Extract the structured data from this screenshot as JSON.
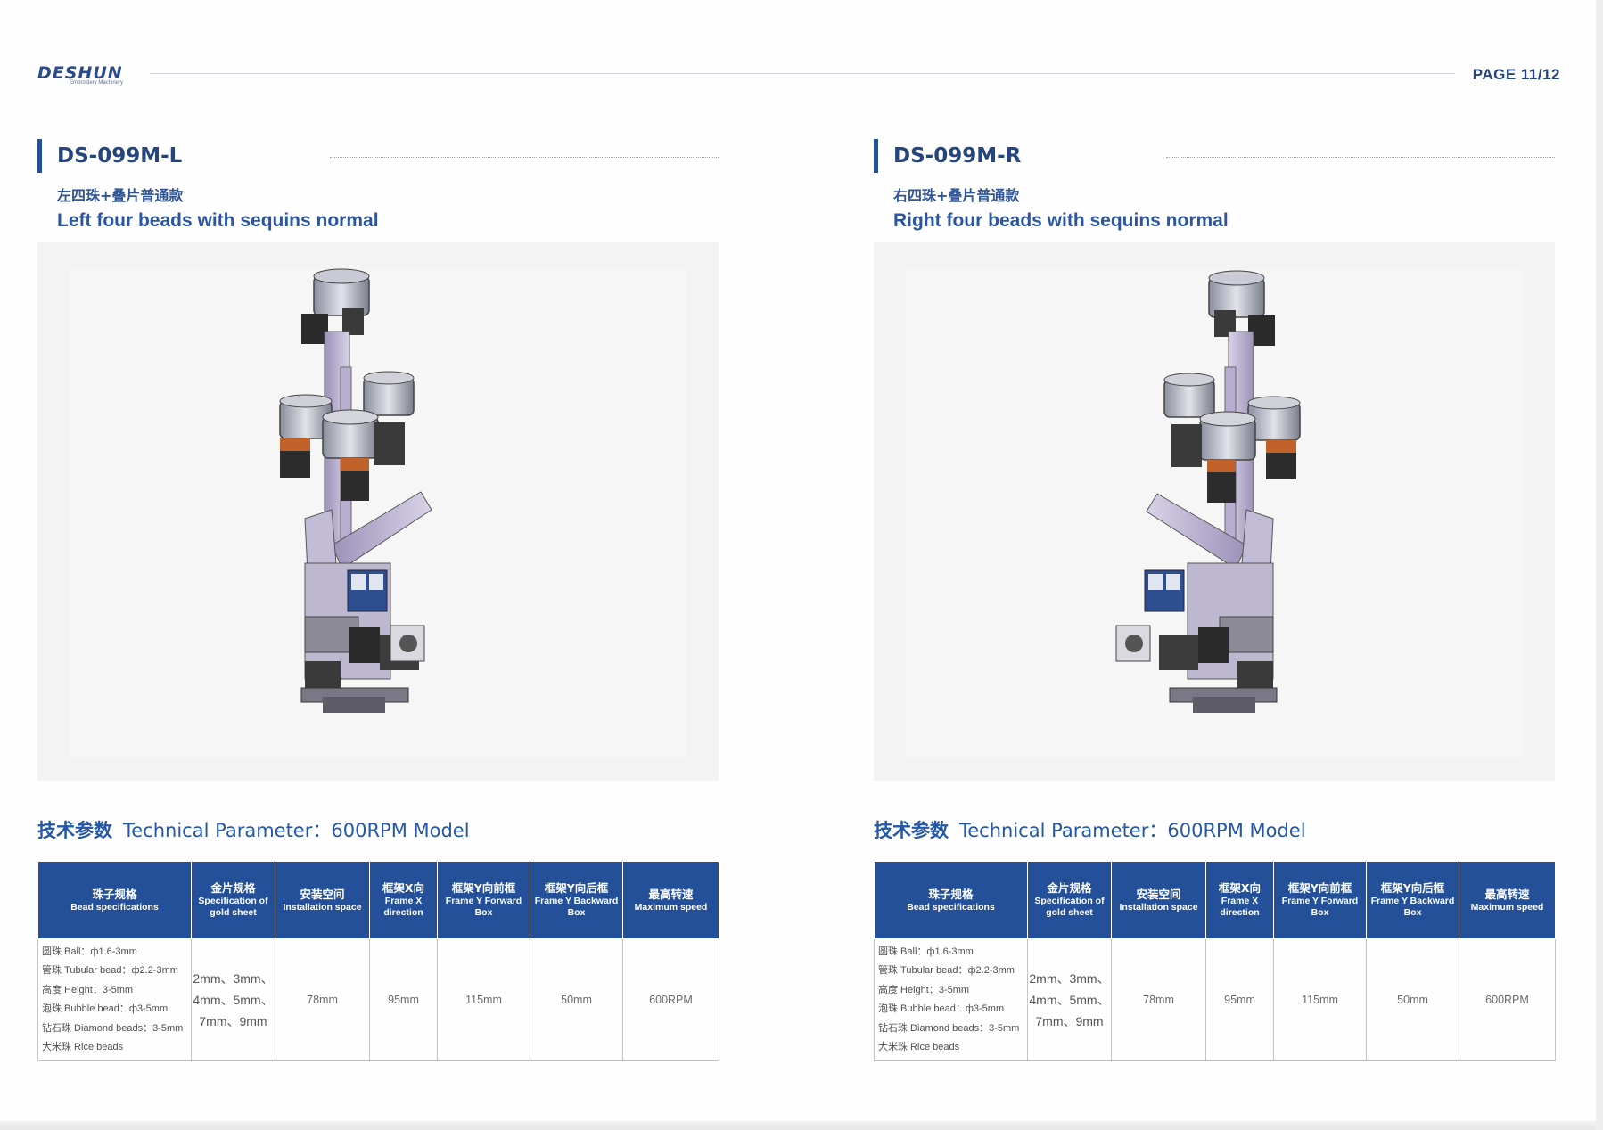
{
  "header": {
    "logo_text": "DESHUN",
    "logo_subtext": "Embroidery Machinery",
    "page_number": "PAGE 11/12"
  },
  "colors": {
    "brand_blue": "#24509a",
    "title_blue": "#24457e",
    "table_header_bg": "#24509a"
  },
  "panels": [
    {
      "model": "DS-099M-L",
      "title_cn": "左四珠+叠片普通款",
      "title_en": "Left four beads with sequins normal",
      "image_icon": "bead-device-left-illustration",
      "tech_heading_cn": "技术参数",
      "tech_heading_en": "Technical Parameter：600RPM Model",
      "table": {
        "headers": [
          {
            "cn": "珠子规格",
            "en": "Bead specifications"
          },
          {
            "cn": "金片规格",
            "en": "Specification of gold sheet"
          },
          {
            "cn": "安装空间",
            "en": "Installation space"
          },
          {
            "cn": "框架X向",
            "en": "Frame X direction"
          },
          {
            "cn": "框架Y向前框",
            "en": "Frame Y Forward Box"
          },
          {
            "cn": "框架Y向后框",
            "en": "Frame Y Backward Box"
          },
          {
            "cn": "最高转速",
            "en": "Maximum speed"
          }
        ],
        "beads": [
          "圆珠 Ball：ф1.6-3mm",
          "管珠 Tubular bead：ф2.2-3mm",
          "高度 Height：3-5mm",
          "泡珠 Bubble bead：ф3-5mm",
          "钻石珠 Diamond beads：3-5mm",
          "大米珠 Rice beads"
        ],
        "gold_sheet": [
          "2mm、3mm、",
          "4mm、5mm、",
          "7mm、9mm"
        ],
        "installation_space": "78mm",
        "frame_x": "95mm",
        "frame_y_forward": "115mm",
        "frame_y_backward": "50mm",
        "max_speed": "600RPM"
      }
    },
    {
      "model": "DS-099M-R",
      "title_cn": "右四珠+叠片普通款",
      "title_en": "Right four beads with sequins normal",
      "image_icon": "bead-device-right-illustration",
      "tech_heading_cn": "技术参数",
      "tech_heading_en": "Technical Parameter：600RPM Model",
      "table": {
        "headers": [
          {
            "cn": "珠子规格",
            "en": "Bead specifications"
          },
          {
            "cn": "金片规格",
            "en": "Specification of gold sheet"
          },
          {
            "cn": "安装空间",
            "en": "Installation space"
          },
          {
            "cn": "框架X向",
            "en": "Frame X direction"
          },
          {
            "cn": "框架Y向前框",
            "en": "Frame Y Forward Box"
          },
          {
            "cn": "框架Y向后框",
            "en": "Frame Y Backward Box"
          },
          {
            "cn": "最高转速",
            "en": "Maximum speed"
          }
        ],
        "beads": [
          "圆珠 Ball：ф1.6-3mm",
          "管珠 Tubular bead：ф2.2-3mm",
          "高度 Height：3-5mm",
          "泡珠 Bubble bead：ф3-5mm",
          "钻石珠 Diamond beads：3-5mm",
          "大米珠 Rice beads"
        ],
        "gold_sheet": [
          "2mm、3mm、",
          "4mm、5mm、",
          "7mm、9mm"
        ],
        "installation_space": "78mm",
        "frame_x": "95mm",
        "frame_y_forward": "115mm",
        "frame_y_backward": "50mm",
        "max_speed": "600RPM"
      }
    }
  ]
}
